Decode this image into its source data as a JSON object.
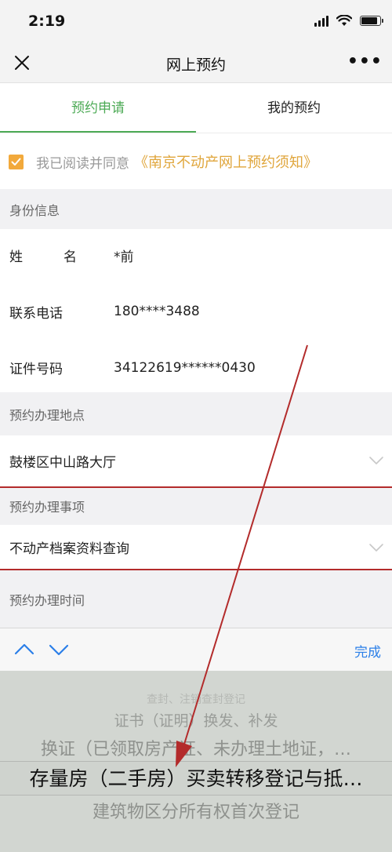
{
  "status_bar": {
    "time": "2:19",
    "icons": [
      "signal-icon",
      "wifi-icon",
      "battery-icon"
    ]
  },
  "nav": {
    "title": "网上预约",
    "close_icon": "close-icon",
    "more_label": "•••"
  },
  "tabs": [
    {
      "label": "预约申请",
      "active": true
    },
    {
      "label": "我的预约",
      "active": false
    }
  ],
  "agreement": {
    "checked": true,
    "text": "我已阅读并同意",
    "link": "《南京不动产网上预约须知》"
  },
  "sections": {
    "identity": "身份信息",
    "location": "预约办理地点",
    "matter": "预约办理事项",
    "time": "预约办理时间"
  },
  "fields": {
    "name": {
      "label_a": "姓",
      "label_b": "名",
      "value": "*前"
    },
    "phone": {
      "label": "联系电话",
      "value": "180****3488"
    },
    "id_number": {
      "label": "证件号码",
      "value": "34122619******0430"
    },
    "location_value": "鼓楼区中山路大厅",
    "matter_value": "不动产档案资料查询"
  },
  "keyboard_toolbar": {
    "done_label": "完成"
  },
  "picker": {
    "options": [
      "查封、注销查封登记",
      "证书（证明）换发、补发",
      "换证（已领取房产证、未办理土地证，…",
      "存量房（二手房）买卖转移登记与抵…",
      "建筑物区分所有权首次登记"
    ],
    "selected_index": 3
  },
  "colors": {
    "accent_green": "#4caa55",
    "checkbox_orange": "#f2a93b",
    "link_gold": "#e0a63c",
    "done_blue": "#2b7fe8",
    "annotation_red": "#b32b2b"
  }
}
